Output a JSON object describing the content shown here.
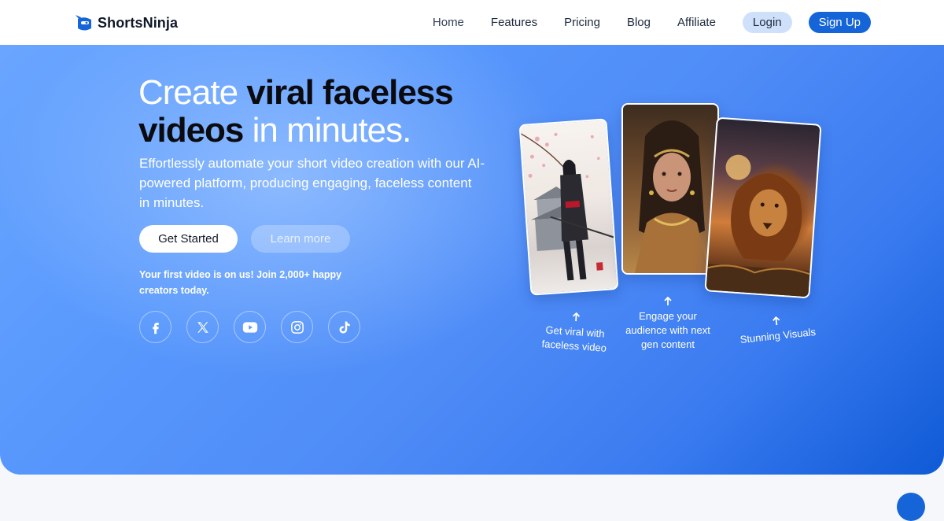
{
  "brand": {
    "name": "ShortsNinja",
    "accent": "#1565d8"
  },
  "nav": {
    "links": [
      "Home",
      "Features",
      "Pricing",
      "Blog",
      "Affiliate"
    ],
    "login_label": "Login",
    "signup_label": "Sign Up"
  },
  "hero": {
    "headline": {
      "part1": "Create ",
      "part2": "viral faceless videos",
      "part3": " in minutes."
    },
    "subtext": "Effortlessly automate your short video creation with our AI-powered platform, producing engaging, faceless content in minutes.",
    "cta_primary": "Get Started",
    "cta_secondary": "Learn more",
    "promo": "Your first video is on us! Join 2,000+ happy creators today.",
    "socials": [
      "facebook-icon",
      "x-icon",
      "youtube-icon",
      "instagram-icon",
      "tiktok-icon"
    ]
  },
  "showcase": {
    "captions": [
      "Get viral with faceless video",
      "Engage your audience with next gen content",
      "Stunning Visuals"
    ]
  }
}
